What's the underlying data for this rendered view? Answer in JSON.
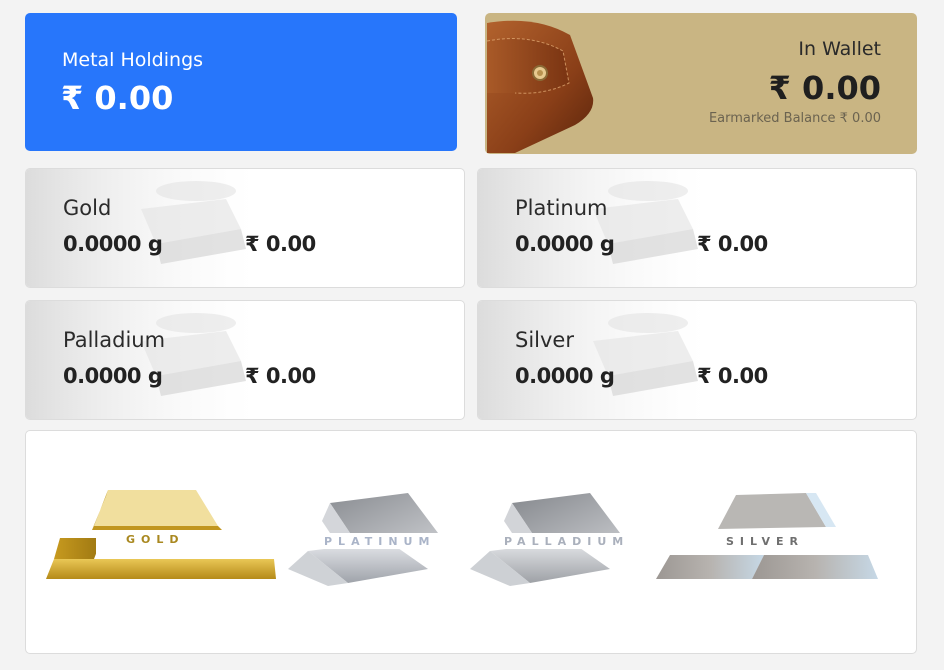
{
  "holdings": {
    "title": "Metal Holdings",
    "amount": "₹ 0.00"
  },
  "wallet": {
    "label": "In Wallet",
    "amount": "₹ 0.00",
    "earmarked": "Earmarked Balance ₹ 0.00"
  },
  "metals": [
    {
      "name": "Gold",
      "grams": "0.0000 g",
      "value": "₹ 0.00"
    },
    {
      "name": "Platinum",
      "grams": "0.0000 g",
      "value": "₹ 0.00"
    },
    {
      "name": "Palladium",
      "grams": "0.0000 g",
      "value": "₹ 0.00"
    },
    {
      "name": "Silver",
      "grams": "0.0000 g",
      "value": "₹ 0.00"
    }
  ],
  "bars": [
    {
      "label": "GOLD",
      "color": "#c9a227"
    },
    {
      "label": "PLATINUM",
      "color": "#b9bcc2"
    },
    {
      "label": "PALLADIUM",
      "color": "#b3b6bb"
    },
    {
      "label": "SILVER",
      "color": "#a9a8a6"
    }
  ],
  "colors": {
    "holdings": "#2776fb",
    "wallet": "#c9b583"
  }
}
